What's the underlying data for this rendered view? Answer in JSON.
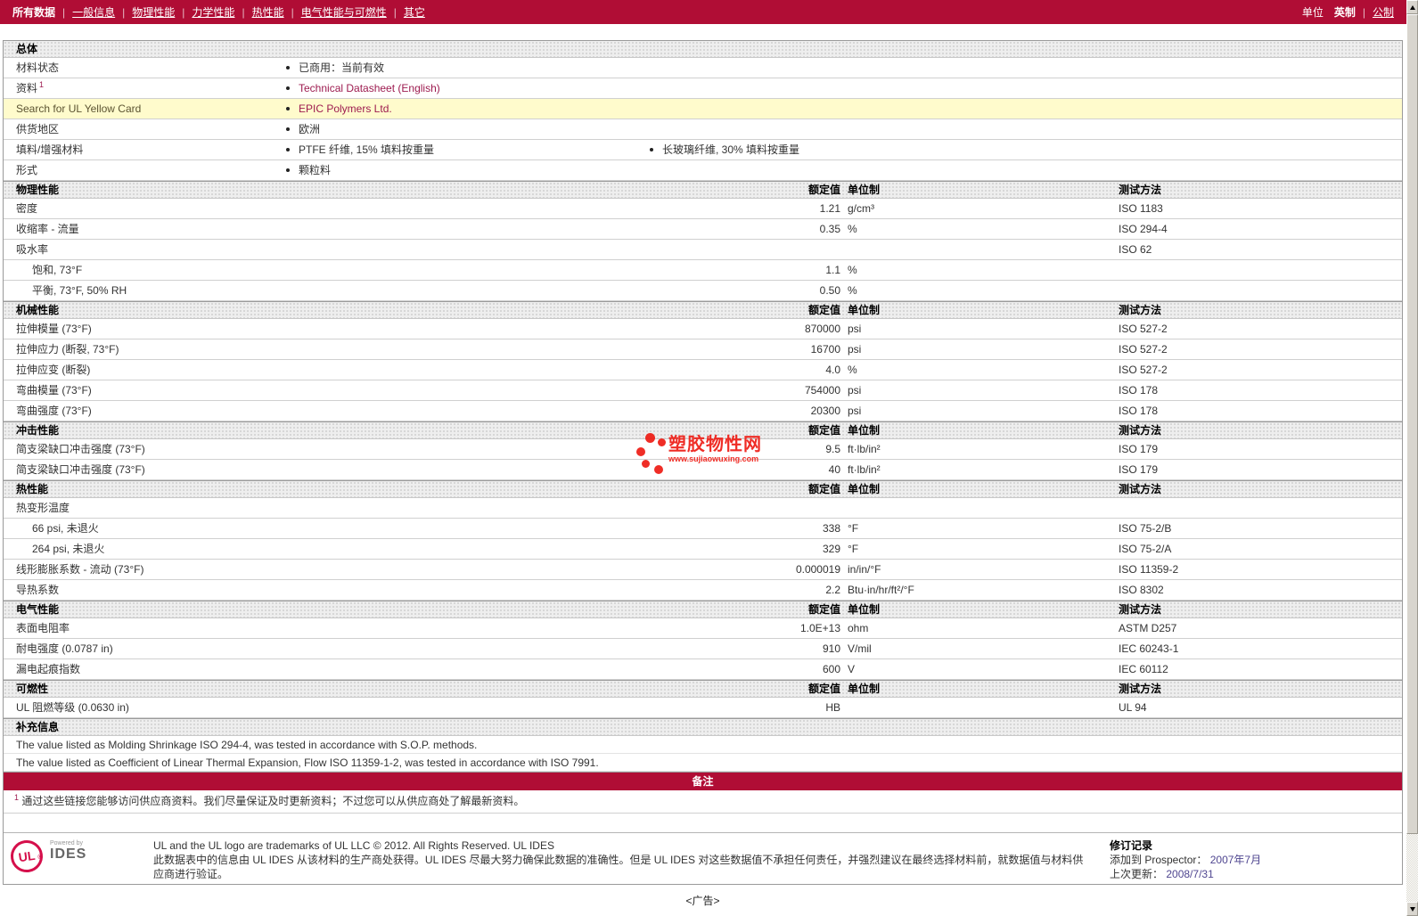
{
  "nav": {
    "tabs": [
      {
        "label": "所有数据",
        "active": true
      },
      {
        "label": "一般信息",
        "active": false
      },
      {
        "label": "物理性能",
        "active": false
      },
      {
        "label": "力学性能",
        "active": false
      },
      {
        "label": "热性能",
        "active": false
      },
      {
        "label": "电气性能与可燃性",
        "active": false
      },
      {
        "label": "其它",
        "active": false
      }
    ],
    "units_label": "单位",
    "units": [
      {
        "label": "英制",
        "active": true
      },
      {
        "label": "公制",
        "active": false
      }
    ]
  },
  "columns": {
    "value": "额定值",
    "unit": "单位制",
    "method": "测试方法"
  },
  "general": {
    "title": "总体",
    "rows": [
      {
        "label": "材料状态",
        "values": [
          "已商用：当前有效"
        ]
      },
      {
        "label": "资料",
        "sup": "1",
        "values": [
          "Technical Datasheet (English)"
        ],
        "link": true
      },
      {
        "label": "Search for UL Yellow Card",
        "values": [
          "EPIC Polymers Ltd."
        ],
        "link": true,
        "highlight": true
      },
      {
        "label": "供货地区",
        "values": [
          "欧洲"
        ]
      },
      {
        "label": "填料/增强材料",
        "values": [
          "PTFE 纤维, 15% 填料按重量",
          "长玻璃纤维, 30% 填料按重量"
        ]
      },
      {
        "label": "形式",
        "values": [
          "颗粒料"
        ]
      }
    ]
  },
  "sections": [
    {
      "title": "物理性能",
      "rows": [
        {
          "label": "密度",
          "value": "1.21",
          "unit": "g/cm³",
          "method": "ISO 1183"
        },
        {
          "label": "收缩率 - 流量",
          "value": "0.35",
          "unit": "%",
          "method": "ISO 294-4"
        },
        {
          "label": "吸水率",
          "value": "",
          "unit": "",
          "method": "ISO 62"
        },
        {
          "label": "饱和, 73°F",
          "indent": 1,
          "value": "1.1",
          "unit": "%",
          "method": ""
        },
        {
          "label": "平衡, 73°F, 50% RH",
          "indent": 1,
          "value": "0.50",
          "unit": "%",
          "method": ""
        }
      ]
    },
    {
      "title": "机械性能",
      "rows": [
        {
          "label": "拉伸模量 (73°F)",
          "value": "870000",
          "unit": "psi",
          "method": "ISO 527-2"
        },
        {
          "label": "拉伸应力 (断裂, 73°F)",
          "value": "16700",
          "unit": "psi",
          "method": "ISO 527-2"
        },
        {
          "label": "拉伸应变 (断裂)",
          "value": "4.0",
          "unit": "%",
          "method": "ISO 527-2"
        },
        {
          "label": "弯曲模量 (73°F)",
          "value": "754000",
          "unit": "psi",
          "method": "ISO 178"
        },
        {
          "label": "弯曲强度 (73°F)",
          "value": "20300",
          "unit": "psi",
          "method": "ISO 178"
        }
      ]
    },
    {
      "title": "冲击性能",
      "rows": [
        {
          "label": "简支梁缺口冲击强度 (73°F)",
          "value": "9.5",
          "unit": "ft·lb/in²",
          "method": "ISO 179"
        },
        {
          "label": "简支梁缺口冲击强度 (73°F)",
          "value": "40",
          "unit": "ft·lb/in²",
          "method": "ISO 179"
        }
      ]
    },
    {
      "title": "热性能",
      "rows": [
        {
          "label": "热变形温度",
          "value": "",
          "unit": "",
          "method": ""
        },
        {
          "label": "66 psi, 未退火",
          "indent": 1,
          "value": "338",
          "unit": "°F",
          "method": "ISO 75-2/B"
        },
        {
          "label": "264 psi, 未退火",
          "indent": 1,
          "value": "329",
          "unit": "°F",
          "method": "ISO 75-2/A"
        },
        {
          "label": "线形膨胀系数 - 流动 (73°F)",
          "value": "0.000019",
          "unit": "in/in/°F",
          "method": "ISO 11359-2"
        },
        {
          "label": "导热系数",
          "value": "2.2",
          "unit": "Btu·in/hr/ft²/°F",
          "method": "ISO 8302"
        }
      ]
    },
    {
      "title": "电气性能",
      "rows": [
        {
          "label": "表面电阻率",
          "value": "1.0E+13",
          "unit": "ohm",
          "method": "ASTM D257"
        },
        {
          "label": "耐电强度 (0.0787 in)",
          "value": "910",
          "unit": "V/mil",
          "method": "IEC 60243-1"
        },
        {
          "label": "漏电起痕指数",
          "value": "600",
          "unit": "V",
          "method": "IEC 60112"
        }
      ]
    },
    {
      "title": "可燃性",
      "rows": [
        {
          "label": "UL 阻燃等级 (0.0630 in)",
          "value": "HB",
          "unit": "",
          "method": "UL 94"
        }
      ]
    }
  ],
  "supplemental": {
    "title": "补充信息",
    "lines": [
      "The value listed as Molding Shrinkage ISO 294-4, was tested in accordance with S.O.P. methods.",
      "The value listed as Coefficient of Linear Thermal Expansion, Flow ISO 11359-1-2, was tested in accordance with ISO 7991."
    ]
  },
  "notes": {
    "banner": "备注",
    "footnote_marker": "1",
    "footnote": "通过这些链接您能够访问供应商资料。我们尽量保证及时更新资料；不过您可以从供应商处了解最新资料。"
  },
  "footer": {
    "ul_mark": "UL",
    "powered_by": "Powered by",
    "brand": "IDES",
    "line1": "UL and the UL logo are trademarks of UL LLC © 2012. All Rights Reserved. UL IDES",
    "line2": "此数据表中的信息由 UL IDES 从该材料的生产商处获得。UL IDES 尽最大努力确保此数据的准确性。但是 UL IDES 对这些数据值不承担任何责任，并强烈建议在最终选择材料前，就数据值与材料供应商进行验证。",
    "revision": {
      "title": "修订记录",
      "added_label": "添加到 Prospector：",
      "added_value": "2007年7月",
      "updated_label": "上次更新：",
      "updated_value": "2008/7/31"
    }
  },
  "ad_text": "<广告>",
  "watermark": {
    "text": "塑胶物性网",
    "url": "www.sujiaowuxing.com"
  },
  "colors": {
    "accent_red": "#B00D35",
    "link": "#9D1B4F",
    "highlight_row": "#FFFBCC",
    "watermark_red": "#EE1C14"
  }
}
